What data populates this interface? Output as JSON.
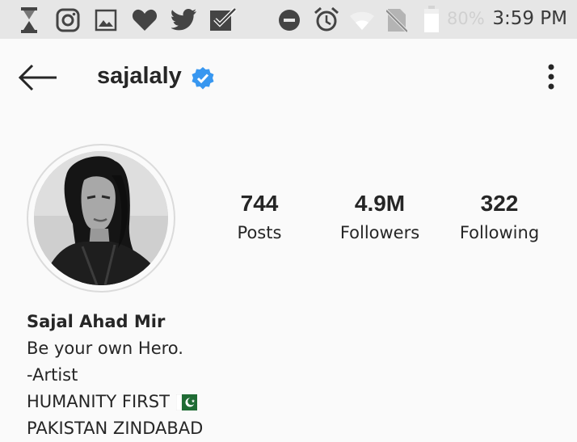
{
  "status_bar": {
    "time": "3:59 PM",
    "battery_percent": "80%",
    "icons": [
      "hourglass-icon",
      "instagram-icon",
      "gallery-icon",
      "heart-icon",
      "twitter-icon",
      "checkbox-icon",
      "do-not-disturb-icon",
      "alarm-icon",
      "wifi-icon",
      "no-sim-icon",
      "battery-icon"
    ]
  },
  "header": {
    "username": "sajalaly",
    "verified": true
  },
  "stats": [
    {
      "value": "744",
      "label": "Posts"
    },
    {
      "value": "4.9M",
      "label": "Followers"
    },
    {
      "value": "322",
      "label": "Following"
    }
  ],
  "bio": {
    "name": "Sajal Ahad Mir",
    "lines": [
      "Be your own Hero.",
      "-Artist",
      "HUMANITY FIRST",
      "PAKISTAN ZINDABAD"
    ]
  },
  "colors": {
    "status_bar_bg": "#e6e6e6",
    "background": "#fafafa",
    "verified_blue": "#3897f0",
    "text": "#262626"
  }
}
